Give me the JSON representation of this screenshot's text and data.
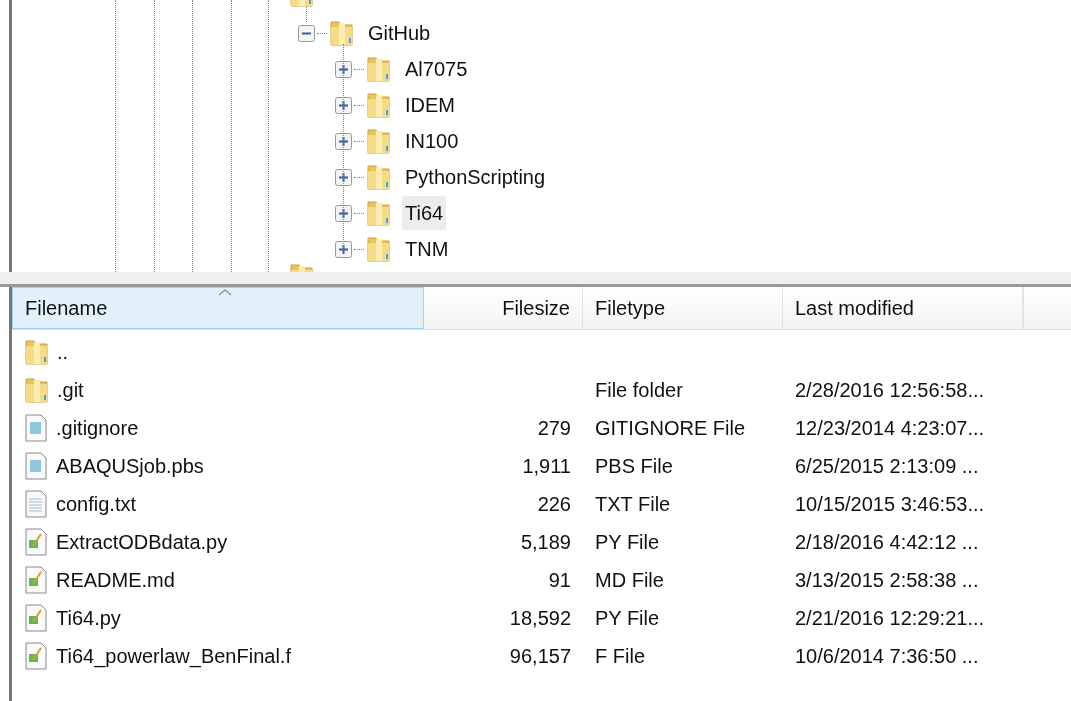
{
  "tree": {
    "items": [
      {
        "label": "GitHub",
        "expanded": true,
        "selected": false,
        "children": [
          {
            "label": "Al7075",
            "expanded": false,
            "selected": false
          },
          {
            "label": "IDEM",
            "expanded": false,
            "selected": false
          },
          {
            "label": "IN100",
            "expanded": false,
            "selected": false
          },
          {
            "label": "PythonScripting",
            "expanded": false,
            "selected": false
          },
          {
            "label": "Ti64",
            "expanded": false,
            "selected": true
          },
          {
            "label": "TNM",
            "expanded": false,
            "selected": false
          }
        ]
      }
    ]
  },
  "file_list": {
    "columns": [
      {
        "label": "Filename",
        "sorted": true,
        "hovered": true
      },
      {
        "label": "Filesize",
        "sorted": false,
        "hovered": false
      },
      {
        "label": "Filetype",
        "sorted": false,
        "hovered": false
      },
      {
        "label": "Last modified",
        "sorted": false,
        "hovered": false
      }
    ],
    "rows": [
      {
        "kind": "folder",
        "name": ".."
      },
      {
        "kind": "folder",
        "name": ".git",
        "type": "File folder",
        "modified": "2/28/2016 12:56:58..."
      },
      {
        "kind": "generic",
        "name": ".gitignore",
        "size": "279",
        "type": "GITIGNORE File",
        "modified": "12/23/2014 4:23:07..."
      },
      {
        "kind": "generic",
        "name": "ABAQUSjob.pbs",
        "size": "1,911",
        "type": "PBS File",
        "modified": "6/25/2015 2:13:09 ..."
      },
      {
        "kind": "text",
        "name": "config.txt",
        "size": "226",
        "type": "TXT File",
        "modified": "10/15/2015 3:46:53..."
      },
      {
        "kind": "script",
        "name": "ExtractODBdata.py",
        "size": "5,189",
        "type": "PY File",
        "modified": "2/18/2016 4:42:12 ..."
      },
      {
        "kind": "script",
        "name": "README.md",
        "size": "91",
        "type": "MD File",
        "modified": "3/13/2015 2:58:38 ..."
      },
      {
        "kind": "script",
        "name": "Ti64.py",
        "size": "18,592",
        "type": "PY File",
        "modified": "2/21/2016 12:29:21..."
      },
      {
        "kind": "script",
        "name": "Ti64_powerlaw_BenFinal.f",
        "size": "96,157",
        "type": "F File",
        "modified": "10/6/2014 7:36:50 ..."
      }
    ]
  }
}
